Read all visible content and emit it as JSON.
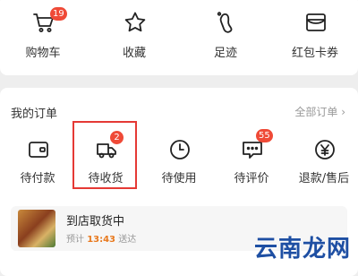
{
  "shortcuts": [
    {
      "label": "购物车",
      "icon": "cart-icon",
      "badge": "19"
    },
    {
      "label": "收藏",
      "icon": "star-icon"
    },
    {
      "label": "足迹",
      "icon": "footprint-icon"
    },
    {
      "label": "红包卡券",
      "icon": "wallet-card-icon"
    }
  ],
  "orders": {
    "title": "我的订单",
    "all_link": "全部订单 ›",
    "statuses": [
      {
        "label": "待付款",
        "icon": "wallet-icon"
      },
      {
        "label": "待收货",
        "icon": "delivery-truck-icon",
        "badge": "2"
      },
      {
        "label": "待使用",
        "icon": "clock-icon"
      },
      {
        "label": "待评价",
        "icon": "comment-icon",
        "badge": "55"
      },
      {
        "label": "退款/售后",
        "icon": "refund-icon"
      }
    ]
  },
  "pickup": {
    "title": "到店取货中",
    "prefix": "预计",
    "time": "13:43",
    "suffix": "送达"
  },
  "watermark": "云南龙网",
  "colors": {
    "badge": "#ef4a37",
    "highlight": "#e53935",
    "time": "#e8791e"
  }
}
